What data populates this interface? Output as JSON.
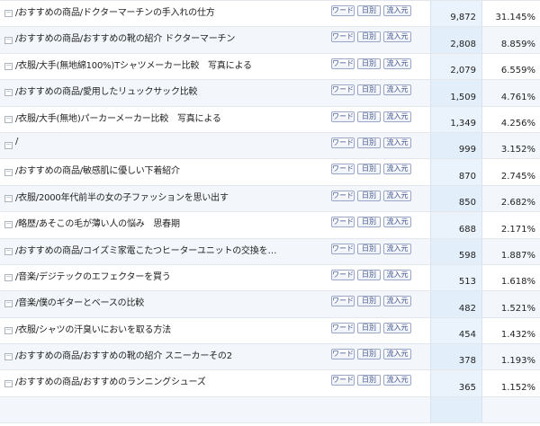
{
  "buttons": {
    "word": "ワード",
    "daily": "日別",
    "source": "流入元"
  },
  "icons": {
    "row": "page-icon"
  },
  "rows": [
    {
      "path": "/おすすめの商品/ドクターマーチンの手入れの仕方",
      "pv": "9,872",
      "pct": "31.145%"
    },
    {
      "path": "/おすすめの商品/おすすめの靴の紹介 ドクターマーチン",
      "pv": "2,808",
      "pct": "8.859%"
    },
    {
      "path": "/衣服/大手(無地綿100%)Tシャツメーカー比較　写真による",
      "pv": "2,079",
      "pct": "6.559%"
    },
    {
      "path": "/おすすめの商品/愛用したリュックサック比較",
      "pv": "1,509",
      "pct": "4.761%"
    },
    {
      "path": "/衣服/大手(無地)パーカーメーカー比較　写真による",
      "pv": "1,349",
      "pct": "4.256%"
    },
    {
      "path": "/",
      "pv": "999",
      "pct": "3.152%"
    },
    {
      "path": "/おすすめの商品/敏感肌に優しい下着紹介",
      "pv": "870",
      "pct": "2.745%"
    },
    {
      "path": "/衣服/2000年代前半の女の子ファッションを思い出す",
      "pv": "850",
      "pct": "2.682%"
    },
    {
      "path": "/略歴/あそこの毛が薄い人の悩み　思春期",
      "pv": "688",
      "pct": "2.171%"
    },
    {
      "path": "/おすすめの商品/コイズミ家電こたつヒーターユニットの交換を…",
      "pv": "598",
      "pct": "1.887%"
    },
    {
      "path": "/音楽/デジテックのエフェクターを買う",
      "pv": "513",
      "pct": "1.618%"
    },
    {
      "path": "/音楽/僕のギターとベースの比較",
      "pv": "482",
      "pct": "1.521%"
    },
    {
      "path": "/衣服/シャツの汗臭いにおいを取る方法",
      "pv": "454",
      "pct": "1.432%"
    },
    {
      "path": "/おすすめの商品/おすすめの靴の紹介 スニーカーその2",
      "pv": "378",
      "pct": "1.193%"
    },
    {
      "path": "/おすすめの商品/おすすめのランニングシューズ",
      "pv": "365",
      "pct": "1.152%"
    },
    {
      "path": "",
      "pv": "",
      "pct": ""
    }
  ]
}
